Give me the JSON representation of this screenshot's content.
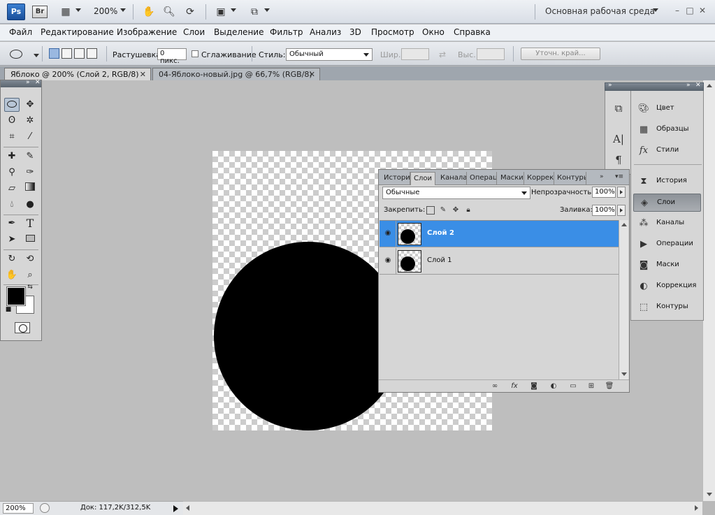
{
  "titlebar": {
    "ps_logo": "Ps",
    "br_logo": "Br",
    "zoom": "200%",
    "workspace": "Основная рабочая среда"
  },
  "menu": [
    "Файл",
    "Редактирование",
    "Изображение",
    "Слои",
    "Выделение",
    "Фильтр",
    "Анализ",
    "3D",
    "Просмотр",
    "Окно",
    "Справка"
  ],
  "options": {
    "feather_label": "Растушевка:",
    "feather_value": "0 пикс.",
    "antialias_label": "Сглаживание",
    "style_label": "Стиль:",
    "style_value": "Обычный",
    "width_label": "Шир.:",
    "height_label": "Выс.:",
    "refine_edge": "Уточн. край..."
  },
  "tabs": {
    "active": "Яблоко @ 200% (Слой 2, RGB/8) *",
    "inactive": "04-Яблоко-новый.jpg @ 66,7% (RGB/8)"
  },
  "status": {
    "zoom": "200%",
    "doc": "Док: 117,2K/312,5K"
  },
  "dock": {
    "items": [
      {
        "label": "Цвет",
        "icon": "color-icon"
      },
      {
        "label": "Образцы",
        "icon": "swatches-icon"
      },
      {
        "label": "Стили",
        "icon": "styles-icon"
      },
      {
        "label": "История",
        "icon": "history-icon"
      },
      {
        "label": "Слои",
        "icon": "layers-icon"
      },
      {
        "label": "Каналы",
        "icon": "channels-icon"
      },
      {
        "label": "Операции",
        "icon": "actions-icon"
      },
      {
        "label": "Маски",
        "icon": "masks-icon"
      },
      {
        "label": "Коррекция",
        "icon": "adjustments-icon"
      },
      {
        "label": "Контуры",
        "icon": "paths-icon"
      }
    ],
    "selected": "Слои"
  },
  "layers_panel": {
    "tabs": [
      "Истори",
      "Слои",
      "Канала",
      "Операц",
      "Маски",
      "Коррек",
      "Контуры"
    ],
    "blend_mode": "Обычные",
    "opacity_label": "Непрозрачность:",
    "opacity_value": "100%",
    "lock_label": "Закрепить:",
    "fill_label": "Заливка:",
    "fill_value": "100%",
    "layers": [
      {
        "name": "Слой 2",
        "selected": true,
        "visible": true
      },
      {
        "name": "Слой 1",
        "selected": false,
        "visible": true
      }
    ]
  },
  "colors": {
    "accent": "#3a8ee6",
    "foreground": "#000000",
    "background": "#ffffff"
  }
}
